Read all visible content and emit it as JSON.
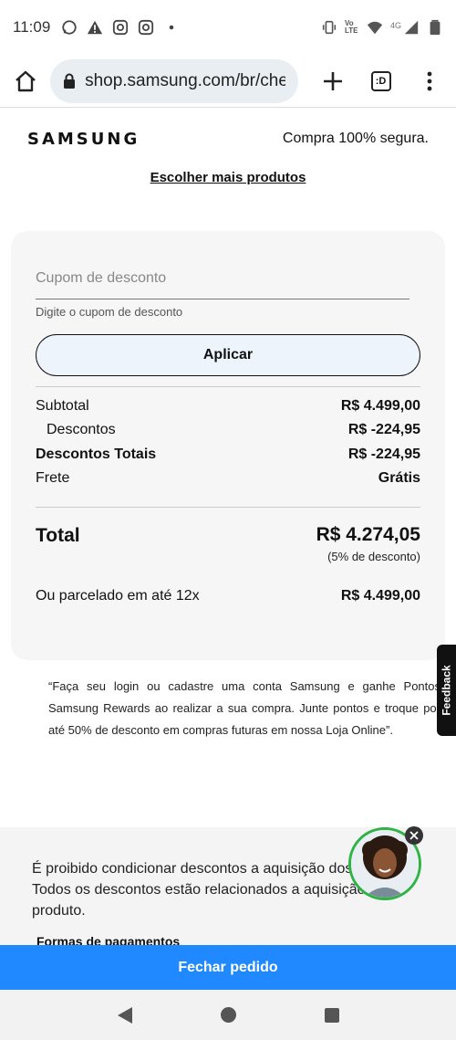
{
  "status": {
    "time": "11:09",
    "icons": [
      "whatsapp-icon",
      "alert-icon",
      "instagram-icon",
      "instagram-icon",
      "dot-icon"
    ],
    "right_icons": [
      "vibrate-icon",
      "volte-icon",
      "wifi-icon",
      "4g-signal-icon",
      "battery-icon"
    ],
    "volte_label": "Vo LTE",
    "network_label": "4G"
  },
  "browser": {
    "url": "shop.samsung.com/br/che",
    "tabs_label": ":D"
  },
  "header": {
    "logo": "SAMSUNG",
    "secure_text": "Compra 100% segura."
  },
  "choose_more": "Escolher mais produtos",
  "coupon": {
    "placeholder": "Cupom de desconto",
    "help": "Digite o cupom de desconto",
    "apply_label": "Aplicar"
  },
  "summary": {
    "subtotal_label": "Subtotal",
    "subtotal_value": "R$ 4.499,00",
    "descontos_label": "Descontos",
    "descontos_value": "R$ -224,95",
    "descontos_totais_label": "Descontos Totais",
    "descontos_totais_value": "R$ -224,95",
    "frete_label": "Frete",
    "frete_value": "Grátis",
    "total_label": "Total",
    "total_value": "R$ 4.274,05",
    "discount_pct": "(5% de desconto)",
    "installments_label": "Ou parcelado em até 12x",
    "installments_value": "R$ 4.499,00"
  },
  "promo_text": "“Faça seu login ou cadastre uma conta Samsung e ganhe Pontos Samsung Rewards ao realizar a sua compra. Junte pontos e troque por até 50% de desconto em compras futuras em nossa Loja Online”.",
  "feedback_label": "Feedback",
  "legal": {
    "text": "É proibido condicionar descontos a aquisição dos produtos. Todos os descontos estão relacionados a aquisição do produto.",
    "payments_label": "Formas de pagamentos"
  },
  "checkout_label": "Fechar pedido",
  "colors": {
    "checkout": "#2189ff",
    "avatar_ring": "#2fb344",
    "card_bg": "#f6f6f6"
  }
}
